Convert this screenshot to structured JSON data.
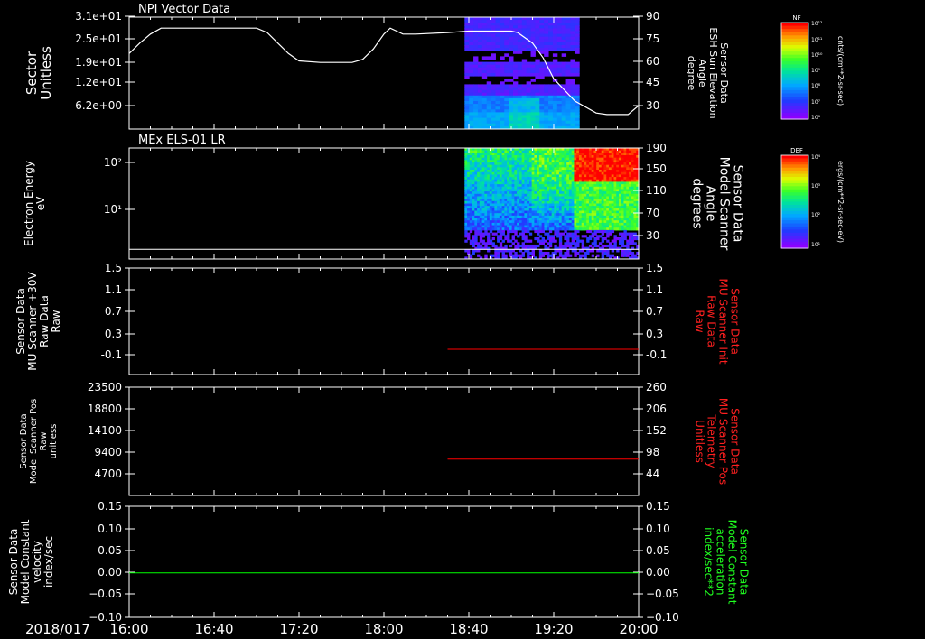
{
  "time_axis": {
    "date": "2018/017",
    "ticks": [
      "16:00",
      "16:40",
      "17:20",
      "18:00",
      "18:40",
      "19:20",
      "20:00"
    ],
    "range": [
      "16:00",
      "20:00"
    ]
  },
  "colorbars": {
    "nf": {
      "title": "NF",
      "unit": "cnts/(cm**2-sr-sec)",
      "labels": [
        "10¹²",
        "10¹¹",
        "10¹⁰",
        "10⁹",
        "10⁸",
        "10⁷",
        "10⁶"
      ]
    },
    "def": {
      "title": "DEF",
      "unit": "ergs/(cm**2-sr-sec-eV)",
      "labels": [
        "10⁴",
        "10³",
        "10²",
        "10¹"
      ]
    }
  },
  "chart_data": [
    {
      "type": "heatmap",
      "title": "NPI Vector Data",
      "ylabel": [
        "Sector",
        "Unitless"
      ],
      "yticks": [
        "3.1e+01",
        "2.5e+01",
        "1.9e+01",
        "1.2e+01",
        "6.2e+00"
      ],
      "y2label": [
        "Sensor Data",
        "ESH Sun Elevation",
        "Angle",
        "degree"
      ],
      "y2ticks": [
        90,
        75,
        60,
        45,
        30
      ],
      "y2lim": [
        15,
        90
      ],
      "data_coverage": [
        "18:38",
        "19:32"
      ],
      "line_series": {
        "name": "ESH Sun Elevation Angle",
        "color": "#ffffff",
        "x": [
          "16:00",
          "16:05",
          "16:10",
          "16:15",
          "16:20",
          "16:30",
          "16:40",
          "16:50",
          "17:00",
          "17:05",
          "17:10",
          "17:15",
          "17:20",
          "17:30",
          "17:40",
          "17:45",
          "17:50",
          "17:55",
          "18:00",
          "18:03",
          "18:06",
          "18:09",
          "18:15",
          "18:30",
          "18:40",
          "19:00",
          "19:03",
          "19:10",
          "19:15",
          "19:20",
          "19:30",
          "19:40",
          "19:45",
          "19:55",
          "20:00"
        ],
        "y": [
          65,
          72,
          78,
          82,
          82,
          82,
          82,
          82,
          82,
          79,
          72,
          65,
          60,
          59,
          59,
          59,
          61,
          68,
          78,
          82,
          80,
          78,
          78,
          79,
          80,
          80,
          79,
          72,
          62,
          48,
          33,
          25,
          24,
          24,
          30
        ]
      }
    },
    {
      "type": "heatmap",
      "title": "MEx ELS-01 LR",
      "ylabel": [
        "Electron Energy",
        "eV"
      ],
      "yticks": [
        "10²",
        "10¹"
      ],
      "y2label": [
        "Sensor Data",
        "Model Scanner",
        "Angle",
        "degrees"
      ],
      "y2ticks": [
        190,
        150,
        110,
        70,
        30
      ],
      "data_coverage": [
        "18:38",
        "20:00"
      ],
      "line_series": {
        "name": "Model Scanner Angle",
        "color": "#ffffff",
        "x": [
          "16:00",
          "20:00"
        ],
        "y": [
          5,
          5
        ]
      }
    },
    {
      "type": "line",
      "ylabel": [
        "Sensor Data",
        "MU Scanner +30V",
        "Raw Data",
        "Raw"
      ],
      "yticks": [
        1.5,
        1.1,
        0.7,
        0.3,
        -0.1
      ],
      "ylim": [
        -0.4,
        1.5
      ],
      "y2label": [
        "Sensor Data",
        "MU Scanner Init",
        "Raw Data",
        "Raw"
      ],
      "y2ticks": [
        1.5,
        1.1,
        0.7,
        0.3,
        -0.1
      ],
      "series": [
        {
          "color": "#ff0000",
          "x": [
            "18:30",
            "20:00"
          ],
          "y": [
            0,
            0
          ]
        }
      ]
    },
    {
      "type": "line",
      "ylabel": [
        "Sensor Data",
        "Model Scanner Pos",
        "Raw",
        "unitless"
      ],
      "yticks": [
        23500,
        18800,
        14100,
        9400,
        4700
      ],
      "ylim": [
        0,
        23500
      ],
      "y2label": [
        "Sensor Data",
        "MU Scanner Pos",
        "Telemetry",
        "Unitless"
      ],
      "y2ticks": [
        260,
        206,
        152,
        98,
        44
      ],
      "series": [
        {
          "color": "#ff0000",
          "x": [
            "18:30",
            "20:00"
          ],
          "y": [
            7900,
            7900
          ]
        }
      ]
    },
    {
      "type": "line",
      "ylabel": [
        "Sensor Data",
        "Model Constant",
        "velocity",
        "index/sec"
      ],
      "yticks": [
        "0.15",
        "0.10",
        "0.05",
        "0.00",
        "−0.05",
        "−0.10"
      ],
      "ylim": [
        -0.1,
        0.15
      ],
      "y2label": [
        "Sensor Data",
        "Model Constant",
        "acceleration",
        "index/sec**2"
      ],
      "y2ticks": [
        "0.15",
        "0.10",
        "0.05",
        "0.00",
        "−0.05",
        "−0.10"
      ],
      "series": [
        {
          "color": "#00ff00",
          "x": [
            "16:00",
            "20:00"
          ],
          "y": [
            0,
            0
          ]
        }
      ]
    }
  ]
}
